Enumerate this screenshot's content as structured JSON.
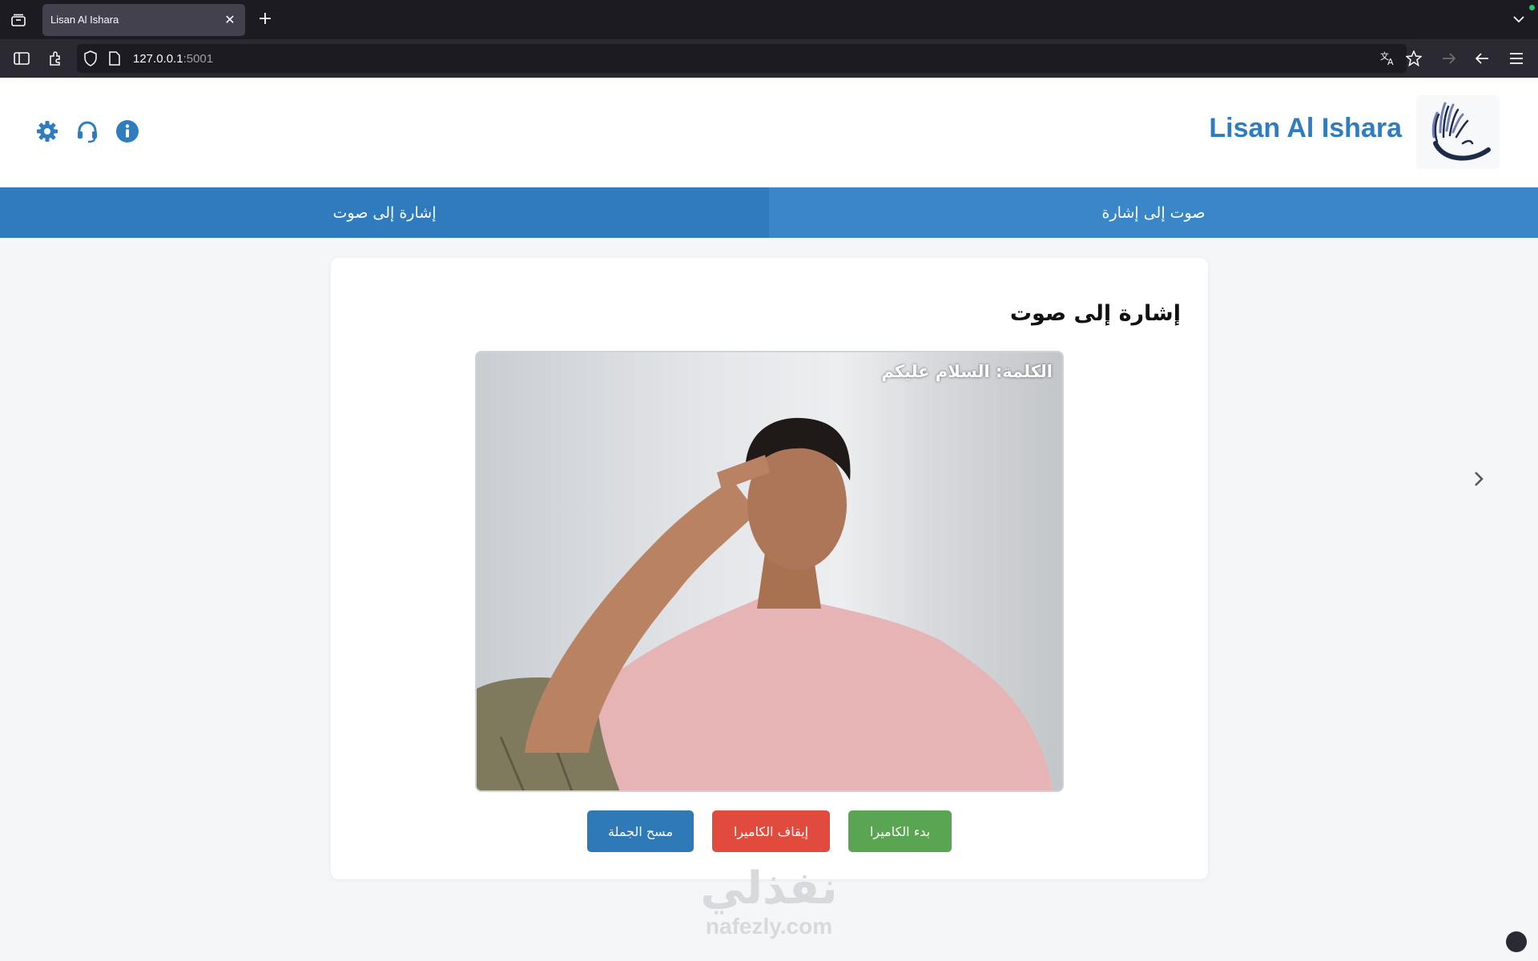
{
  "browser": {
    "tab_title": "Lisan Al Ishara",
    "url_host": "127.0.0.1",
    "url_port": ":5001"
  },
  "header": {
    "brand": "Lisan Al Ishara",
    "icons": [
      "settings-icon",
      "headset-icon",
      "info-icon"
    ]
  },
  "modes": {
    "sign_to_speech": "إشارة إلى صوت",
    "speech_to_sign": "صوت إلى إشارة"
  },
  "card": {
    "title": "إشارة إلى صوت",
    "word_label": "الكلمة: السلام عليكم",
    "buttons": {
      "start": "بدء الكاميرا",
      "stop": "إيقاف الكاميرا",
      "clear": "مسح الجملة"
    }
  },
  "watermark": {
    "arabic": "نفذلي",
    "latin": "nafezly.com"
  },
  "colors": {
    "brand": "#2f7dbf",
    "tab_bar": "#3a86c8",
    "start": "#5aa552",
    "stop": "#e04b3e",
    "clear": "#2f79b6"
  }
}
